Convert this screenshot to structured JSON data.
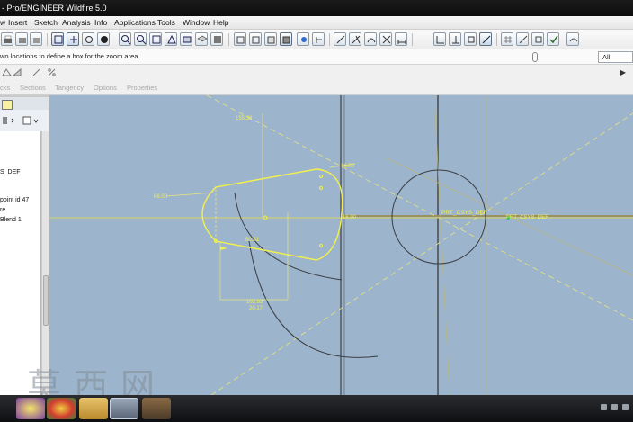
{
  "window": {
    "title": "- Pro/ENGINEER Wildfire 5.0"
  },
  "menu": [
    "w",
    "Insert",
    "Sketch",
    "Analysis",
    "Info",
    "Applications",
    "Tools",
    "Window",
    "Help"
  ],
  "message": "wo locations to define a box for the zoom area.",
  "filter": {
    "value": "All"
  },
  "dashboard_tabs": [
    "cks",
    "Sections",
    "Tangency",
    "Options",
    "Properties"
  ],
  "model_tree": [
    "S_DEF",
    "point id 47",
    "re",
    "Blend 1"
  ],
  "sketch": {
    "dims": [
      "155.38",
      "16.00",
      "66.00",
      "60.51",
      "102.63",
      "20.17",
      "16.00"
    ],
    "csys_label": "PRT_CSYS_DEF",
    "csys_label2": "PRT_CSYS_DEF"
  },
  "watermark": "莫西网",
  "colors": {
    "canvas": "#9cb4cc",
    "sketch": "#f2f04a",
    "geometry": "#3a3e44"
  }
}
